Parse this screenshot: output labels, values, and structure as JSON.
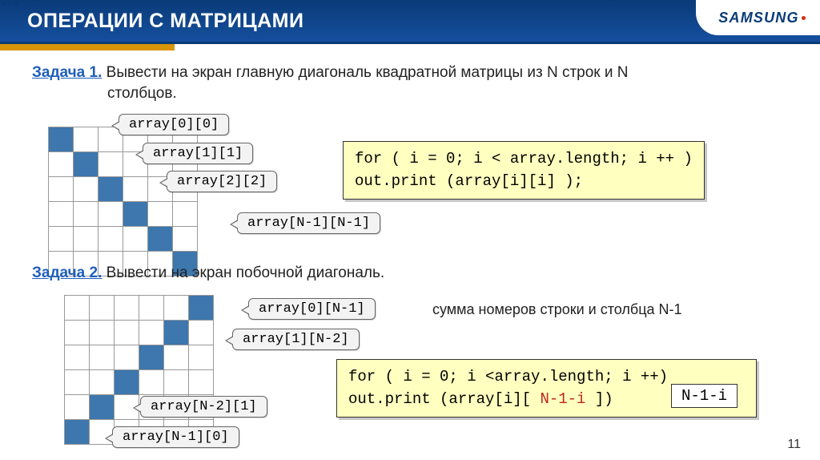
{
  "header": {
    "title": "ОПЕРАЦИИ С МАТРИЦАМИ",
    "logo": "SAMSUNG"
  },
  "task1": {
    "label": "Задача 1.",
    "text": "Вывести на экран главную диагональ квадратной матрицы из N строк и N",
    "text2": "столбцов.",
    "callouts": [
      "array[0][0]",
      "array[1][1]",
      "array[2][2]",
      "array[N-1][N-1]"
    ],
    "code_line1_a": "for ( i = 0;  i < ",
    "code_line1_b": "array.length",
    "code_line1_c": ";  i ++ )",
    "code_line2_a": "  out.print (",
    "code_line2_b": "array[i][i]",
    "code_line2_c": " );"
  },
  "task2": {
    "label": "Задача 2.",
    "text": "Вывести на экран побочной диагональ.",
    "callouts": [
      "array[0][N-1]",
      "array[1][N-2]",
      "array[N-2][1]",
      "array[N-1][0]"
    ],
    "note": "сумма номеров строки и столбца N-1",
    "code_line1_a": "for ( i = 0;  i <",
    "code_line1_b": "array.length",
    "code_line1_c": "; i ++)",
    "code_line2_a": "  out.print (",
    "code_line2_b": "array[i][",
    "code_line2_c": " N-1-i ",
    "code_line2_d": "])",
    "highlight": "N-1-i"
  },
  "grids": {
    "g1_diag": [
      [
        0,
        0
      ],
      [
        1,
        1
      ],
      [
        2,
        2
      ],
      [
        3,
        3
      ],
      [
        4,
        4
      ],
      [
        5,
        5
      ]
    ],
    "g2_anti": [
      [
        0,
        5
      ],
      [
        1,
        4
      ],
      [
        2,
        3
      ],
      [
        3,
        2
      ],
      [
        4,
        1
      ],
      [
        5,
        0
      ]
    ]
  },
  "page": "11"
}
